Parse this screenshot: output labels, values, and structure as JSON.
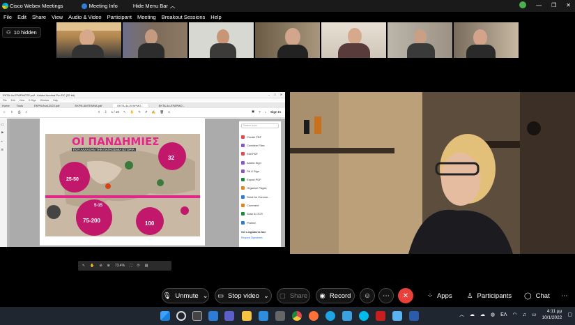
{
  "window": {
    "app_title": "Cisco Webex Meetings",
    "meeting_info": "Meeting Info",
    "hide_menu": "Hide Menu Bar"
  },
  "menu": [
    "File",
    "Edit",
    "Share",
    "View",
    "Audio & Video",
    "Participant",
    "Meeting",
    "Breakout Sessions",
    "Help"
  ],
  "hidden_count": "10 hidden",
  "shared_app": {
    "title": "EKTA-4o-EFAPMOTE.pdf - Adobe Acrobat Pro DC (32-bit)",
    "menu": [
      "File",
      "Edit",
      "View",
      "E-Sign",
      "Window",
      "Help"
    ],
    "tabs": [
      "Home",
      "Tools",
      "EKPN-final-2022.pdf",
      "EKPN-AMTEMNA.pdf",
      "EKTA-4o-EFAPMO...",
      "EKTA-4o-EFAPMO..."
    ],
    "sign_in": "Sign In",
    "page_indicator": "1 / 18",
    "zoom_level": "73.4%",
    "search_placeholder": "Search tools",
    "tools": [
      {
        "label": "Create PDF",
        "color": "#e34850"
      },
      {
        "label": "Combine Files",
        "color": "#8b56c5"
      },
      {
        "label": "Edit PDF",
        "color": "#e34850"
      },
      {
        "label": "Adobe Sign",
        "color": "#8b56c5"
      },
      {
        "label": "Fill & Sign",
        "color": "#8b56c5"
      },
      {
        "label": "Export PDF",
        "color": "#1b8a3b"
      },
      {
        "label": "Organize Pages",
        "color": "#e0861a"
      },
      {
        "label": "Send for Comme...",
        "color": "#2d7cd6"
      },
      {
        "label": "Comment",
        "color": "#e0861a"
      },
      {
        "label": "Scan & OCR",
        "color": "#1b8a3b"
      },
      {
        "label": "Protect",
        "color": "#2d7cd6"
      }
    ],
    "promo_title": "Get e-signatures fast",
    "promo_link": "Request Signatures",
    "poster": {
      "title": "ΟΙ ΠΑΝΔΗΜΙΕΣ",
      "subtitle": "ΠΟΥ ΑΛΛΑΞΑΝ ΤΗΝ ΠΑΓΚΟΣΜΙΑ ΙΣΤΟΡΙΑ",
      "stats": [
        "25-50",
        "75-200",
        "100",
        "32",
        "5-15"
      ]
    }
  },
  "controls": {
    "unmute": "Unmute",
    "stop_video": "Stop video",
    "share": "Share",
    "record": "Record",
    "apps": "Apps",
    "participants": "Participants",
    "chat": "Chat"
  },
  "tray": {
    "language": "ΕΛ",
    "time": "4:11 μμ",
    "date": "10/1/2022"
  },
  "colors": {
    "end_call": "#e8413b",
    "accent": "#00bceb"
  }
}
